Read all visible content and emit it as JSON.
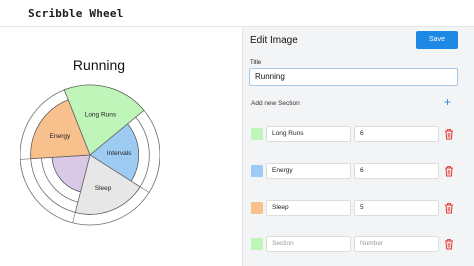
{
  "app": {
    "logo": "Scribble Wheel"
  },
  "wheel": {
    "title": "Running",
    "sections": [
      {
        "name": "Long Runs",
        "value": 6,
        "color": "#bff5b8"
      },
      {
        "name": "Intervals",
        "value": 4,
        "color": "#9ecbf2"
      },
      {
        "name": "Sleep",
        "value": 5,
        "color": "#e7e7e7"
      },
      {
        "name": "",
        "value": 3,
        "color": "#d9c9e6"
      },
      {
        "name": "Energy",
        "value": 5,
        "color": "#f8c08c"
      }
    ],
    "max_rings": 6
  },
  "panel": {
    "heading": "Edit Image",
    "save_label": "Save",
    "title_label": "Title",
    "title_value": "Running",
    "add_section_label": "Add new Section"
  },
  "rows": [
    {
      "color": "#bff5b8",
      "name": "Long Runs",
      "number": "6"
    },
    {
      "color": "#9ecbf2",
      "name": "Energy",
      "number": "6"
    },
    {
      "color": "#f8c08c",
      "name": "Sleep",
      "number": "5"
    }
  ],
  "new_row": {
    "color": "#bff5b8",
    "name_placeholder": "Section",
    "number_placeholder": "Number"
  }
}
